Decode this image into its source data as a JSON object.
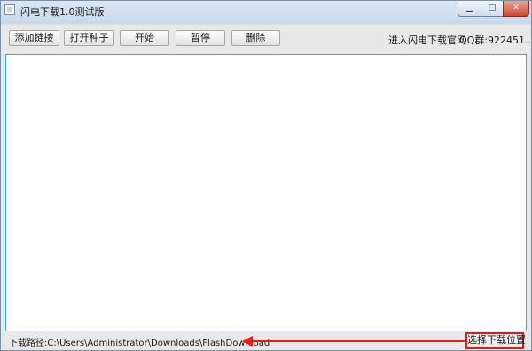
{
  "window": {
    "title": "闪电下载1.0测试版",
    "minimize_glyph": "▁",
    "maximize_glyph": "□",
    "close_glyph": "✕"
  },
  "toolbar": {
    "add_link": "添加链接",
    "open_torrent": "打开种子",
    "start": "开始",
    "pause": "暂停",
    "delete": "删除",
    "official_site": "进入闪电下载官网",
    "qq_group": "QQ群:922451..."
  },
  "status": {
    "download_path": "下载路径:C:\\Users\\Administrator\\Downloads\\FlashDownload",
    "choose_location": "选择下载位置"
  },
  "colors": {
    "list_border": "#3ea6dc",
    "highlight": "#e02020"
  }
}
